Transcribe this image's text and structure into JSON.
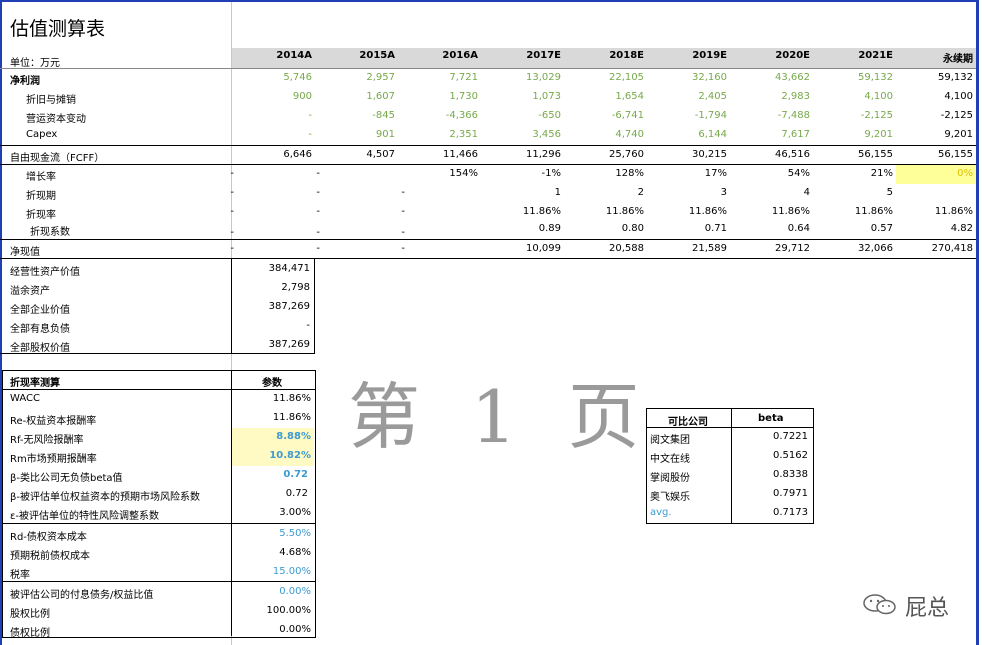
{
  "sheet_title": "估值测算表",
  "unit_label": "单位：万元",
  "years": [
    "2014A",
    "2015A",
    "2016A",
    "2017E",
    "2018E",
    "2019E",
    "2020E",
    "2021E",
    "永续期"
  ],
  "rows": {
    "net_profit": {
      "label": "净利润",
      "vals": [
        "5,746",
        "2,957",
        "7,721",
        "13,029",
        "22,105",
        "32,160",
        "43,662",
        "59,132",
        "59,132"
      ]
    },
    "depreciation": {
      "label": "折旧与摊销",
      "vals": [
        "900",
        "1,607",
        "1,730",
        "1,073",
        "1,654",
        "2,405",
        "2,983",
        "4,100",
        "4,100"
      ]
    },
    "working_capital": {
      "label": "营运资本变动",
      "vals": [
        "-",
        "-845",
        "-4,366",
        "-650",
        "-6,741",
        "-1,794",
        "-7,488",
        "-2,125",
        "-2,125"
      ]
    },
    "capex": {
      "label": "Capex",
      "vals": [
        "-",
        "901",
        "2,351",
        "3,456",
        "4,740",
        "6,144",
        "7,617",
        "9,201",
        "9,201"
      ]
    },
    "fcff": {
      "label": "自由现金流（FCFF）",
      "vals": [
        "6,646",
        "4,507",
        "11,466",
        "11,296",
        "25,760",
        "30,215",
        "46,516",
        "56,155",
        "56,155"
      ]
    },
    "growth": {
      "label": "增长率",
      "vals": [
        "-",
        "-",
        "154%",
        "-1%",
        "128%",
        "17%",
        "54%",
        "21%",
        "0%"
      ]
    },
    "period": {
      "label": "折现期",
      "vals": [
        "-",
        "-",
        "-",
        "1",
        "2",
        "3",
        "4",
        "5",
        ""
      ]
    },
    "discount_rate": {
      "label": "折现率",
      "vals": [
        "-",
        "-",
        "-",
        "11.86%",
        "11.86%",
        "11.86%",
        "11.86%",
        "11.86%",
        "11.86%"
      ]
    },
    "discount_factor": {
      "label": "折现系数",
      "vals": [
        "-",
        "-",
        "-",
        "0.89",
        "0.80",
        "0.71",
        "0.64",
        "0.57",
        "4.82"
      ]
    },
    "npv": {
      "label": "净现值",
      "vals": [
        "-",
        "-",
        "-",
        "10,099",
        "20,588",
        "21,589",
        "29,712",
        "32,066",
        "270,418"
      ]
    }
  },
  "valuation": [
    {
      "label": "经营性资产价值",
      "value": "384,471"
    },
    {
      "label": "溢余资产",
      "value": "2,798"
    },
    {
      "label": "全部企业价值",
      "value": "387,269"
    },
    {
      "label": "全部有息负债",
      "value": "-"
    },
    {
      "label": "全部股权价值",
      "value": "387,269"
    }
  ],
  "discount_calc": {
    "header_label": "折现率测算",
    "header_param": "参数",
    "items": [
      {
        "label": "WACC",
        "value": "11.86%"
      },
      {
        "label": "Re-权益资本报酬率",
        "value": "11.86%"
      },
      {
        "label": "Rf-无风险报酬率",
        "value": "8.88%"
      },
      {
        "label": "Rm市场预期报酬率",
        "value": "10.82%"
      },
      {
        "label": "β-类比公司无负债beta值",
        "value": "0.72"
      },
      {
        "label": "β-被评估单位权益资本的预期市场风险系数",
        "value": "0.72"
      },
      {
        "label": "ε-被评估单位的特性风险调整系数",
        "value": "3.00%"
      },
      {
        "label": "Rd-债权资本成本",
        "value": "5.50%"
      },
      {
        "label": "预期税前债权成本",
        "value": "4.68%"
      },
      {
        "label": "税率",
        "value": "15.00%"
      },
      {
        "label": "被评估公司的付息债务/权益比值",
        "value": "0.00%"
      },
      {
        "label": "股权比例",
        "value": "100.00%"
      },
      {
        "label": "债权比例",
        "value": "0.00%"
      }
    ]
  },
  "comparables": {
    "header_company": "可比公司",
    "header_beta": "beta",
    "items": [
      {
        "name": "阅文集团",
        "beta": "0.7221"
      },
      {
        "name": "中文在线",
        "beta": "0.5162"
      },
      {
        "name": "掌阅股份",
        "beta": "0.8338"
      },
      {
        "name": "奥飞娱乐",
        "beta": "0.7971"
      },
      {
        "name": "avg.",
        "beta": "0.7173"
      }
    ]
  },
  "watermark": "第 1 页",
  "brand_text": "屁总",
  "colors": {
    "frame": "#1f3fb5",
    "green": "#77a94a",
    "blue": "#3d9bd0",
    "yellow": "#ffff99"
  }
}
